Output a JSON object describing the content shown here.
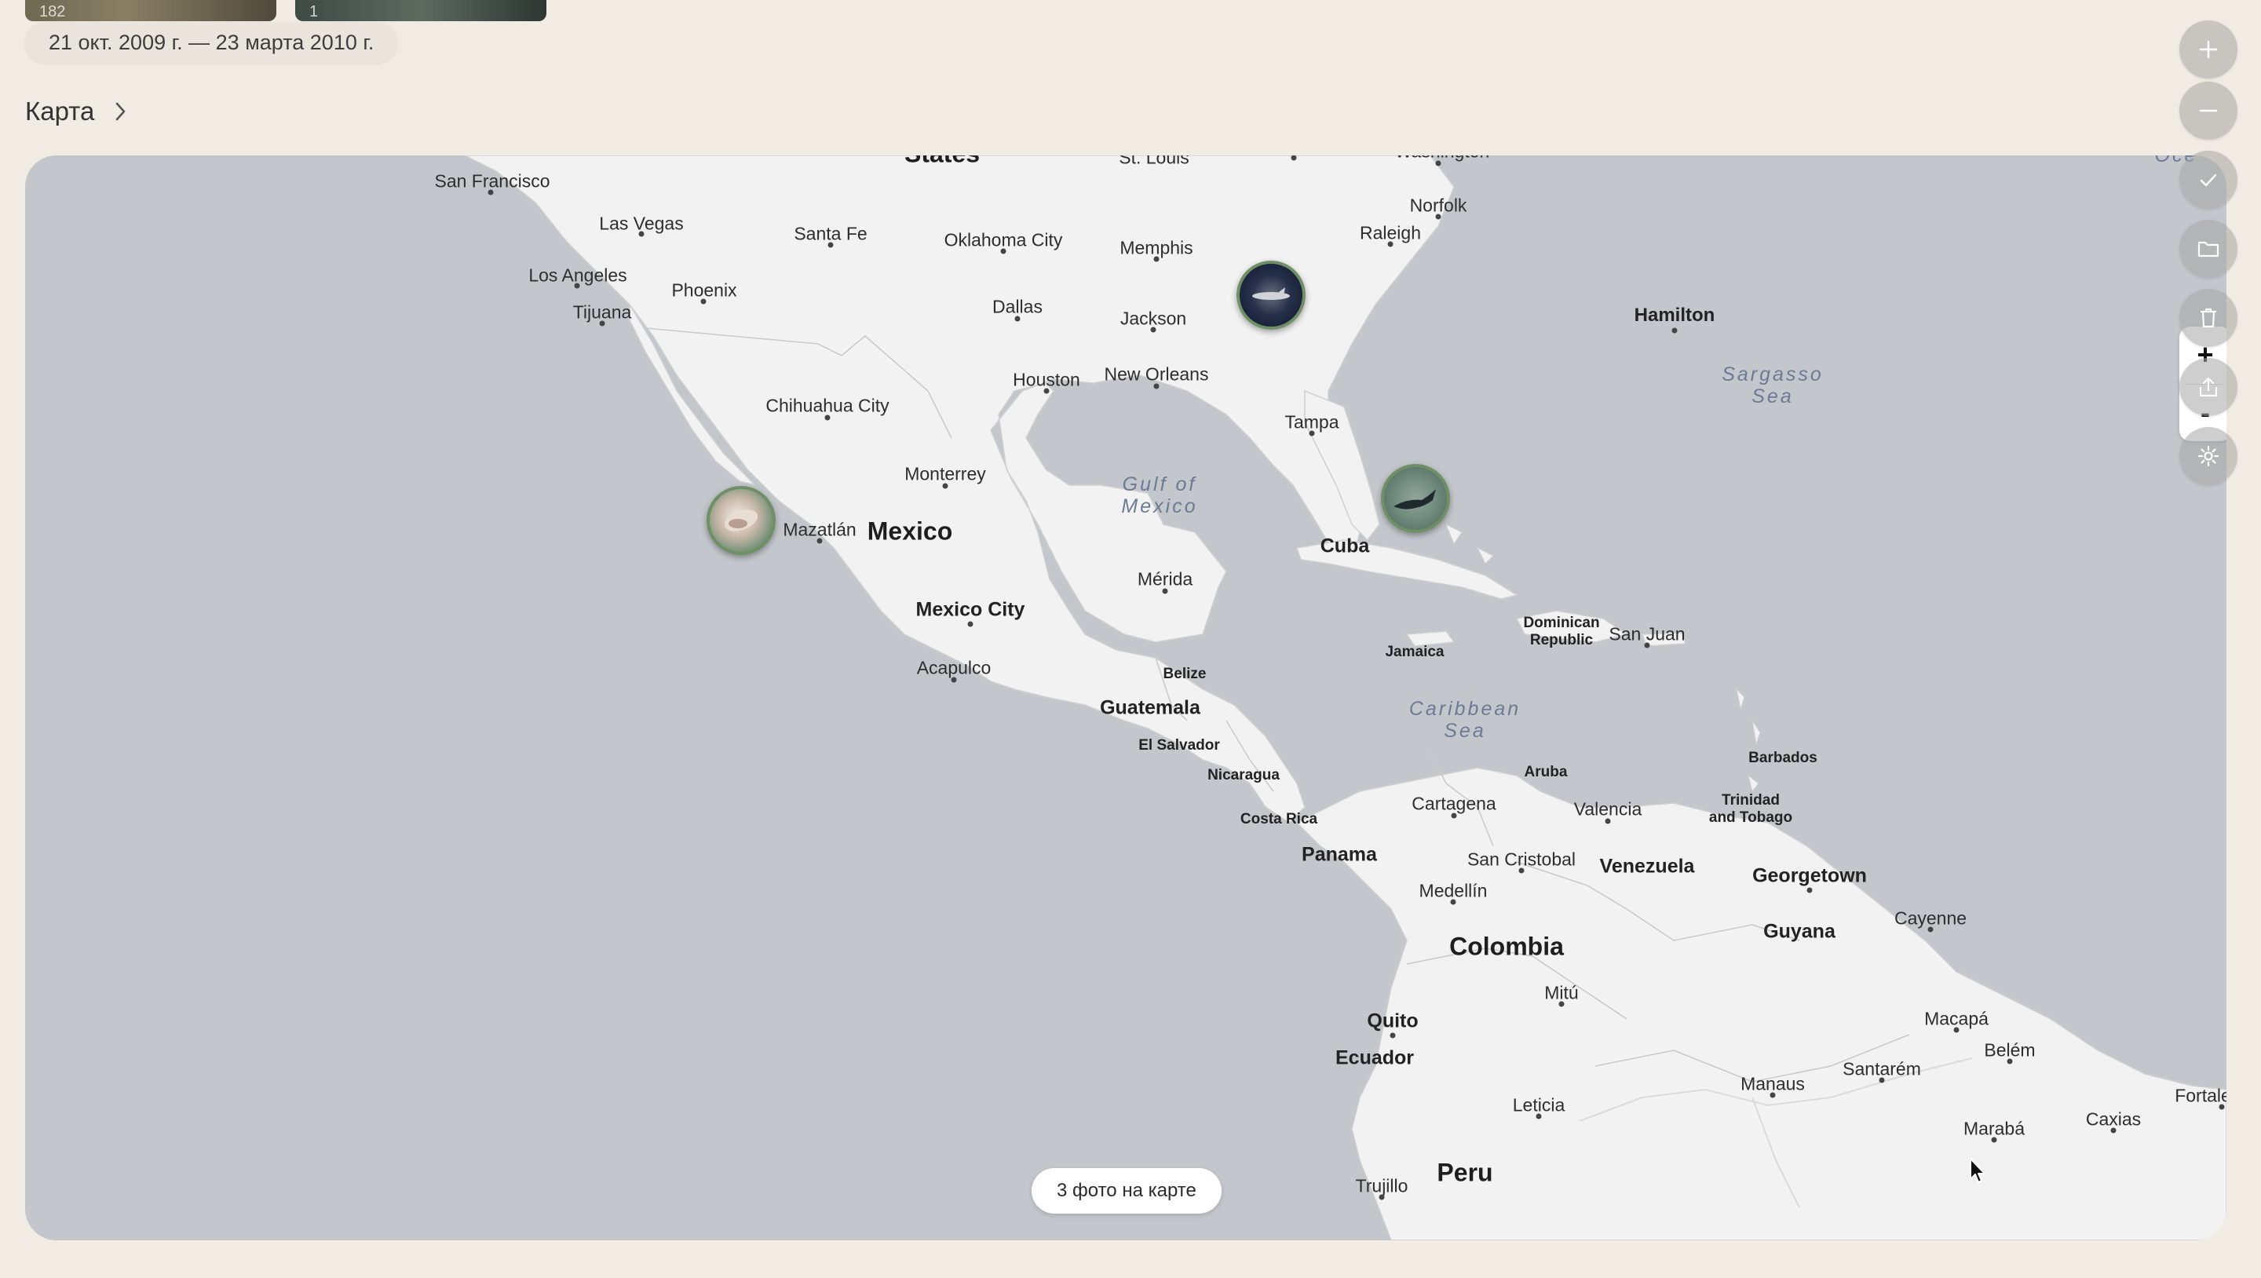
{
  "top_thumbnails": [
    {
      "count": "182"
    },
    {
      "count": "1"
    }
  ],
  "date_range": "21 окт. 2009 г. — 23 марта 2010 г.",
  "section": {
    "title": "Карта",
    "chevron_icon": "chevron-right-icon"
  },
  "map": {
    "photos_counter": "3 фото на карте",
    "zoom_in_label": "+",
    "zoom_out_label": "-",
    "countries": {
      "mexico": "Mexico",
      "cuba": "Cuba",
      "guatemala": "Guatemala",
      "panama": "Panama",
      "colombia": "Colombia",
      "venezuela": "Venezuela",
      "guyana": "Guyana",
      "ecuador": "Ecuador",
      "peru": "Peru",
      "belize": "Belize",
      "el_salvador": "El Salvador",
      "nicaragua": "Nicaragua",
      "costa_rica": "Costa Rica",
      "jamaica": "Jamaica",
      "dominican_republic": "Dominican\nRepublic",
      "barbados": "Barbados",
      "trinidad": "Trinidad\nand Tobago",
      "aruba": "Aruba",
      "states": "States"
    },
    "seas": {
      "gulf": "Gulf of\nMexico",
      "caribbean": "Caribbean\nSea",
      "sargasso": "Sargasso\nSea",
      "ocean": "Oce"
    },
    "cities": {
      "san_francisco": "San Francisco",
      "las_vegas": "Las Vegas",
      "los_angeles": "Los Angeles",
      "tijuana": "Tijuana",
      "phoenix": "Phoenix",
      "santa_fe": "Santa Fe",
      "oklahoma_city": "Oklahoma City",
      "dallas": "Dallas",
      "houston": "Houston",
      "memphis": "Memphis",
      "jackson": "Jackson",
      "new_orleans": "New Orleans",
      "st_louis": "St. Louis",
      "washington": "Washington",
      "norfolk": "Norfolk",
      "raleigh": "Raleigh",
      "tampa": "Tampa",
      "hamilton": "Hamilton",
      "chihuahua_city": "Chihuahua City",
      "monterrey": "Monterrey",
      "mazatlan": "Mazatlán",
      "mexico_city": "Mexico City",
      "acapulco": "Acapulco",
      "merida": "Mérida",
      "san_juan": "San Juan",
      "cartagena": "Cartagena",
      "valencia": "Valencia",
      "san_cristobal": "San Cristobal",
      "medellin": "Medellín",
      "georgetown": "Georgetown",
      "cayenne": "Cayenne",
      "mitu": "Mitú",
      "quito": "Quito",
      "leticia": "Leticia",
      "trujillo": "Trujillo",
      "manaus": "Manaus",
      "santarem": "Santarém",
      "macapa": "Macapá",
      "belem": "Belém",
      "maraba": "Marabá",
      "caxias": "Caxias",
      "fortaleza": "Fortale"
    }
  },
  "right_toolbar": [
    {
      "icon": "plus-icon"
    },
    {
      "icon": "minus-icon"
    },
    {
      "icon": "checkmark-icon"
    },
    {
      "icon": "folder-icon"
    },
    {
      "icon": "trash-icon"
    },
    {
      "icon": "share-icon"
    },
    {
      "icon": "gear-icon"
    }
  ],
  "colors": {
    "page_bg": "#f1ece3",
    "water": "#c3c7cb",
    "land": "#f2f2f2",
    "pin_border": "#6f8f66"
  }
}
